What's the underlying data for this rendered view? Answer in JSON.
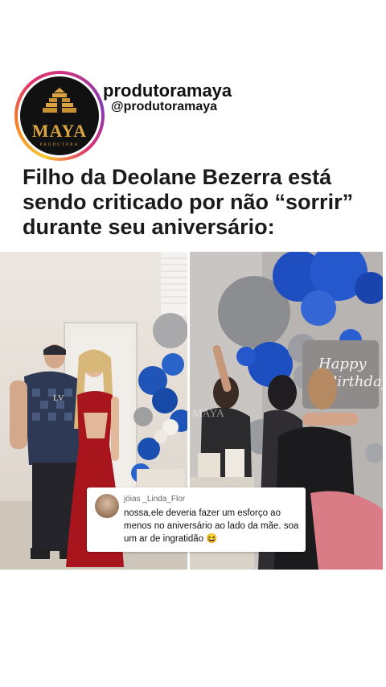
{
  "profile": {
    "display_name": "produtoramaya",
    "handle": "@produtoramaya",
    "logo_text": "MAYA",
    "logo_subtext": "PRODUTORA",
    "ring_colors": [
      "#f9c531",
      "#f77f21",
      "#e1306c",
      "#c13584",
      "#833ab4"
    ]
  },
  "headline": "Filho da Deolane Bezerra está sendo criticado por não “sorrir” durante seu aniversário:",
  "photos": {
    "shirt_text": "LV",
    "cake_sign": "Happy Birthday",
    "watermark": "MAYA"
  },
  "comment": {
    "username": "jóias _Linda_Flor",
    "text": "nossa,ele deveria fazer um esforço ao menos no aniversário ao lado da mãe. soa um ar de ingratidão 😆"
  }
}
